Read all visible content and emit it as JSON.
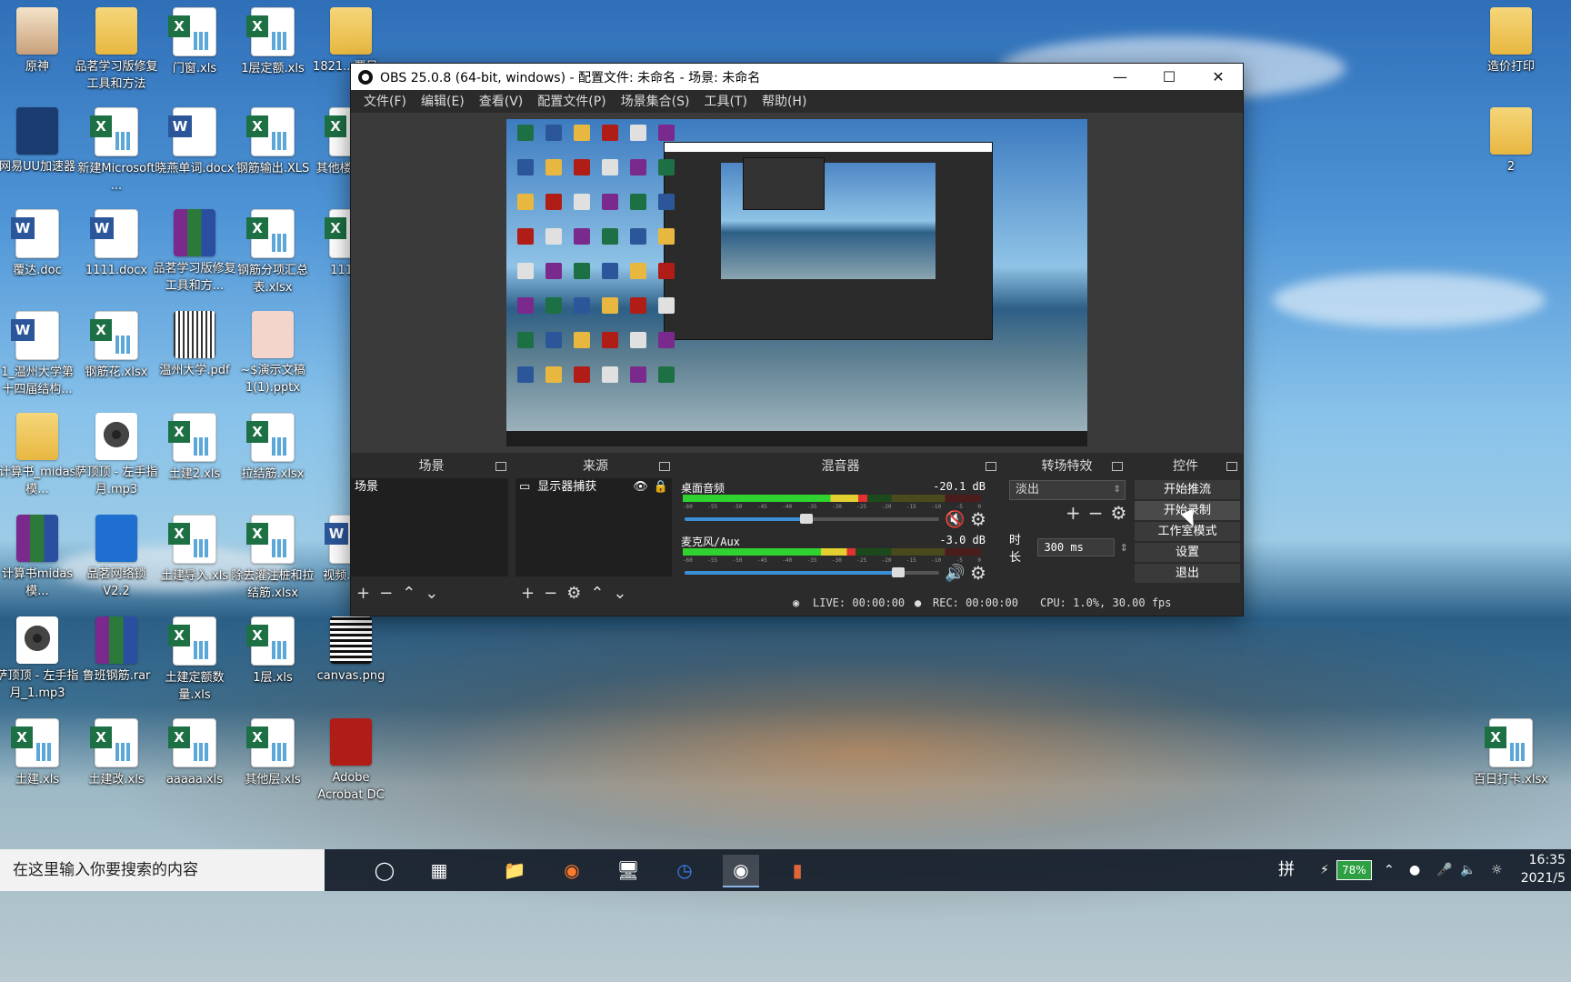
{
  "desktop": {
    "icons_left": [
      {
        "label": "原神",
        "kind": "game"
      },
      {
        "label": "品茗学习版修复工具和方法",
        "kind": "folder"
      },
      {
        "label": "门窗.xls",
        "kind": "xls"
      },
      {
        "label": "1层定额.xls",
        "kind": "xls"
      },
      {
        "label": "1821...覃日...",
        "kind": "folder"
      },
      {
        "label": "网易UU加速器",
        "kind": "app"
      },
      {
        "label": "新建Microsoft ...",
        "kind": "xls"
      },
      {
        "label": "晓燕单词.docx",
        "kind": "doc"
      },
      {
        "label": "钢筋输出.XLS",
        "kind": "xls"
      },
      {
        "label": "其他楼...额...",
        "kind": "xls"
      },
      {
        "label": "覆达.doc",
        "kind": "doc"
      },
      {
        "label": "1111.docx",
        "kind": "doc"
      },
      {
        "label": "品茗学习版修复工具和方...",
        "kind": "rar"
      },
      {
        "label": "钢筋分项汇总表.xlsx",
        "kind": "xls"
      },
      {
        "label": "1111...",
        "kind": "xls"
      },
      {
        "label": "1_温州大学第十四届结构...",
        "kind": "doc"
      },
      {
        "label": "钢筋花.xlsx",
        "kind": "xls"
      },
      {
        "label": "温州大学.pdf",
        "kind": "scan"
      },
      {
        "label": "~$演示文稿1(1).pptx",
        "kind": "ppt"
      },
      {
        "label": "计算书_midas模...",
        "kind": "folder"
      },
      {
        "label": "萨顶顶 - 左手指月.mp3",
        "kind": "mp3"
      },
      {
        "label": "土建2.xls",
        "kind": "xls"
      },
      {
        "label": "拉结筋.xlsx",
        "kind": "xls"
      },
      {
        "label": "计算书midas模...",
        "kind": "rar"
      },
      {
        "label": "品茗网络锁V2.2",
        "kind": "wifi"
      },
      {
        "label": "土建导入.xls",
        "kind": "xls"
      },
      {
        "label": "除去灌注桩和拉结筋.xlsx",
        "kind": "xls"
      },
      {
        "label": "视频...doc",
        "kind": "doc"
      },
      {
        "label": "萨顶顶 - 左手指月_1.mp3",
        "kind": "mp3"
      },
      {
        "label": "鲁班钢筋.rar",
        "kind": "rar"
      },
      {
        "label": "土建定额数量.xls",
        "kind": "xls"
      },
      {
        "label": "1层.xls",
        "kind": "xls"
      },
      {
        "label": "canvas.png",
        "kind": "qr"
      },
      {
        "label": "土建.xls",
        "kind": "xls"
      },
      {
        "label": "土建改.xls",
        "kind": "xls"
      },
      {
        "label": "aaaaa.xls",
        "kind": "xls"
      },
      {
        "label": "其他层.xls",
        "kind": "xls"
      },
      {
        "label": "Adobe Acrobat DC",
        "kind": "pdf"
      }
    ],
    "icons_right": [
      {
        "label": "造价打印",
        "kind": "folder"
      },
      {
        "label": "2",
        "kind": "folder"
      },
      {
        "label": "百日打卡.xlsx",
        "kind": "xls"
      }
    ]
  },
  "obs": {
    "title": "OBS 25.0.8 (64-bit, windows) - 配置文件: 未命名 - 场景: 未命名",
    "menu": [
      "文件(F)",
      "编辑(E)",
      "查看(V)",
      "配置文件(P)",
      "场景集合(S)",
      "工具(T)",
      "帮助(H)"
    ],
    "docks": {
      "scenes": {
        "title": "场景",
        "items": [
          "场景"
        ]
      },
      "sources": {
        "title": "来源",
        "items": [
          "显示器捕获"
        ]
      },
      "mixer": {
        "title": "混音器",
        "tracks": [
          {
            "name": "桌面音频",
            "db": "-20.1 dB",
            "level": 0.62,
            "fader": 0.48,
            "muted": true
          },
          {
            "name": "麦克风/Aux",
            "db": "-3.0 dB",
            "level": 0.58,
            "fader": 0.84,
            "muted": false
          }
        ],
        "scale": [
          "-60",
          "-55",
          "-50",
          "-45",
          "-40",
          "-35",
          "-30",
          "-25",
          "-20",
          "-15",
          "-10",
          "-5",
          "0"
        ]
      },
      "transitions": {
        "title": "转场特效",
        "selected": "淡出",
        "duration_label": "时长",
        "duration_value": "300 ms"
      },
      "controls": {
        "title": "控件",
        "buttons": [
          "开始推流",
          "开始录制",
          "工作室模式",
          "设置",
          "退出"
        ]
      }
    },
    "status": {
      "live": "LIVE: 00:00:00",
      "rec": "REC: 00:00:00",
      "cpu": "CPU: 1.0%, 30.00 fps"
    }
  },
  "taskbar": {
    "search_placeholder": "在这里输入你要搜索的内容",
    "battery": "78%",
    "ime": "拼",
    "time": "16:35",
    "date": "2021/5"
  },
  "colors": {
    "obs_bg": "#2b2b2b",
    "meter_green": "#2fd22f",
    "fader_blue": "#3b8fd6",
    "mute_red": "#e03030"
  }
}
